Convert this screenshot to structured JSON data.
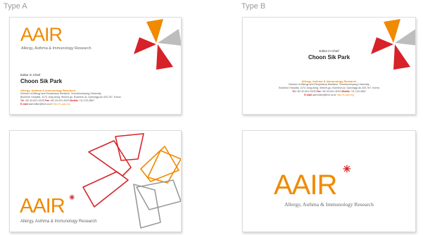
{
  "type_a_label": "Type A",
  "type_b_label": "Type B",
  "brand": {
    "logo": "AAIR",
    "tagline_a": "Allergy, Asthma & Immunology Research",
    "tagline_b": "Allergy, Asthma & Immunology Research"
  },
  "card_a_front": {
    "role": "Editor in Chief",
    "name": "Choon Sik Park",
    "journal": "Allergy, Asthma & Immunology Research",
    "division": "Division of Allergy and Respiratory Medicine, Soonchunhyang University",
    "address": "Bucheon Hospital, 1174 Jung-dong, Wonmi-gu, Bucheon-si, Gyeonggi-do 420-767, Korea",
    "tel_label": "Tel",
    "tel": "+82-32-621-5105",
    "fax_label": "Fax",
    "fax": "+82-32-621-5023",
    "mobile_label": "Mobile",
    "mobile": "+11-123-4567",
    "email_label": "E-mail",
    "email": "aair.editor@live.co.kr",
    "web": "http://e-aair.org"
  },
  "card_b_front": {
    "role": "Editor in Chief",
    "name": "Choon Sik Park",
    "journal": "Allergy, Asthma & Immunology Research",
    "division": "Division of Allergy and Respiratory Medicine, Soonchunhyang University",
    "address": "Bucheon Hospital, 1174 Jung-dong, Wonmi-gu, Bucheon-si, Gyeonggi-do 420-767, Korea",
    "tel_label": "Tel",
    "tel": "+82-32-621-5105",
    "fax_label": "Fax",
    "fax": "+82-32-621-5023",
    "mobile_label": "Mobile",
    "mobile": "+11-123-4567",
    "email_label": "E-mail",
    "email": "aair.editor@live.co.kr",
    "web": "http://e-aair.org"
  },
  "colors": {
    "orange": "#f08a00",
    "red": "#d62228",
    "gray": "#9a9a9a",
    "text": "#555555"
  }
}
